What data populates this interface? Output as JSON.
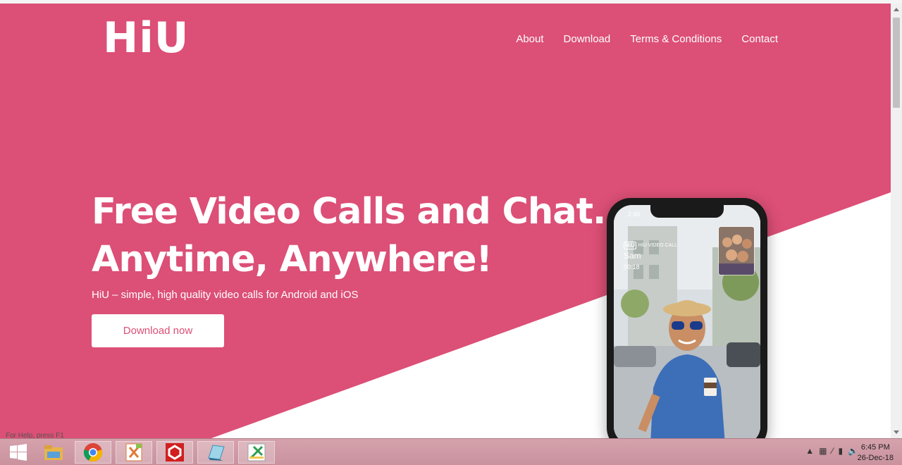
{
  "site": {
    "logo": "HiU",
    "nav": [
      "About",
      "Download",
      "Terms & Conditions",
      "Contact"
    ]
  },
  "hero": {
    "headline_line1": "Free Video Calls and Chat.",
    "headline_line2": "Anytime, Anywhere!",
    "subline": "HiU – simple, high quality video calls for Android and iOS",
    "cta": "Download now"
  },
  "phone": {
    "time": "2:46",
    "badge_logo": "HiU",
    "badge_text": "HIU VIDEO CALL",
    "caller": "Sam",
    "duration": "00:18"
  },
  "taskbar": {
    "ghost_text": "For Help, press F1",
    "apps": [
      "windows-start-icon",
      "file-explorer-icon",
      "chrome-icon",
      "xampp-icon",
      "app-red-icon",
      "app-blue-icon",
      "app-green-icon"
    ],
    "clock_time": "6:45 PM",
    "clock_date": "26-Dec-18"
  },
  "colors": {
    "brand_pink": "#dc4f76",
    "white": "#ffffff"
  }
}
